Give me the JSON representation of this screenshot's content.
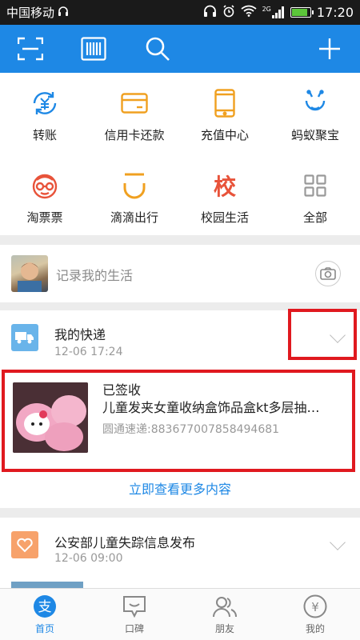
{
  "status_bar": {
    "carrier": "中国移动",
    "network": "2G",
    "time": "17:20",
    "battery_level": 0.9
  },
  "toolbar": {
    "icons": [
      "scan-icon",
      "barcode-icon",
      "search-icon",
      "plus-icon"
    ]
  },
  "grid": [
    {
      "label": "转账",
      "icon": "transfer-icon",
      "color": "#1e88e5"
    },
    {
      "label": "信用卡还款",
      "icon": "credit-card-icon",
      "color": "#f0a020"
    },
    {
      "label": "充值中心",
      "icon": "phone-icon",
      "color": "#f0a020"
    },
    {
      "label": "蚂蚁聚宝",
      "icon": "ant-icon",
      "color": "#1e88e5"
    },
    {
      "label": "淘票票",
      "icon": "ticket-face-icon",
      "color": "#e8533a"
    },
    {
      "label": "滴滴出行",
      "icon": "didi-icon",
      "color": "#f0a020"
    },
    {
      "label": "校园生活",
      "icon": "campus-icon",
      "color": "#e8533a",
      "glyph": "校"
    },
    {
      "label": "全部",
      "icon": "grid-icon",
      "color": "#999999"
    }
  ],
  "record": {
    "text": "记录我的生活"
  },
  "express": {
    "title": "我的快递",
    "time": "12-06 17:24",
    "item": {
      "status": "已签收",
      "name": "儿童发夹女童收纳盒饰品盒kt多层抽…",
      "tracking": "圆通速递:883677007858494681"
    },
    "more_link": "立即查看更多内容"
  },
  "notice": {
    "title": "公安部儿童失踪信息发布",
    "time": "12-06 09:00"
  },
  "tabs": [
    {
      "label": "首页",
      "icon": "home-icon",
      "active": true
    },
    {
      "label": "口碑",
      "icon": "koubei-icon",
      "active": false
    },
    {
      "label": "朋友",
      "icon": "friends-icon",
      "active": false
    },
    {
      "label": "我的",
      "icon": "wallet-icon",
      "active": false
    }
  ],
  "colors": {
    "primary": "#1e88e5",
    "highlight_box": "#e0191f"
  }
}
